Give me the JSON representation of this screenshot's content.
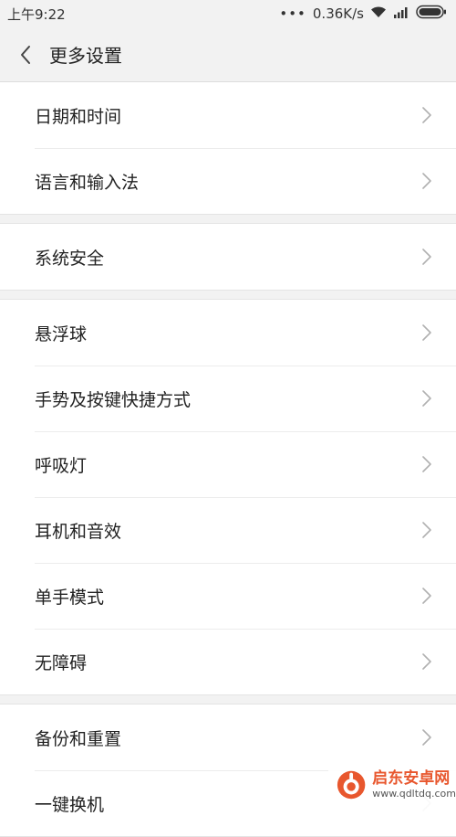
{
  "status_bar": {
    "time": "上午9:22",
    "dots": "•••",
    "network_speed": "0.36K/s",
    "icons": [
      "wifi-icon",
      "signal-icon",
      "battery-icon"
    ]
  },
  "header": {
    "back_icon": "chevron-left-icon",
    "title": "更多设置"
  },
  "groups": [
    {
      "items": [
        {
          "label": "日期和时间"
        },
        {
          "label": "语言和输入法"
        }
      ]
    },
    {
      "items": [
        {
          "label": "系统安全"
        }
      ]
    },
    {
      "items": [
        {
          "label": "悬浮球"
        },
        {
          "label": "手势及按键快捷方式"
        },
        {
          "label": "呼吸灯"
        },
        {
          "label": "耳机和音效"
        },
        {
          "label": "单手模式"
        },
        {
          "label": "无障碍"
        }
      ]
    },
    {
      "items": [
        {
          "label": "备份和重置"
        },
        {
          "label": "一键换机"
        }
      ]
    }
  ],
  "watermark": {
    "name": "启东安卓网",
    "url": "www.qdltdq.com",
    "brand_color": "#e8572e"
  },
  "colors": {
    "background": "#f2f2f2",
    "row_background": "#ffffff",
    "chevron": "#b0b0b0"
  }
}
